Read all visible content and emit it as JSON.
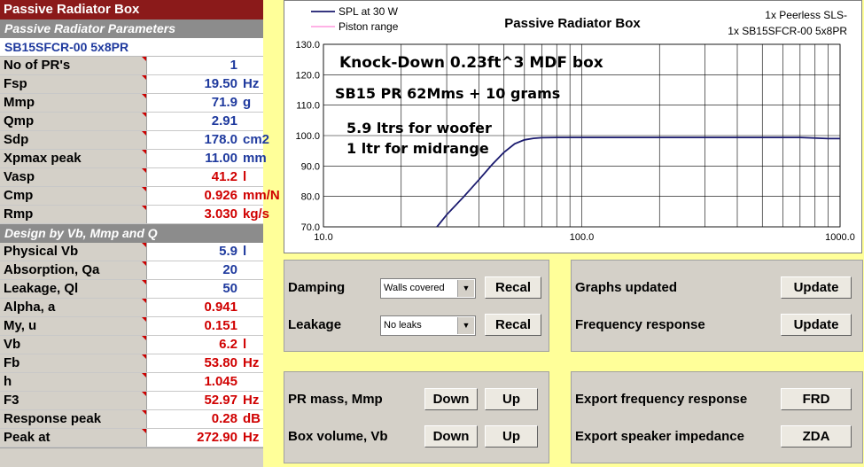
{
  "left": {
    "title": "Passive Radiator Box",
    "section1": "Passive Radiator Parameters",
    "model": "SB15SFCR-00 5x8PR",
    "params": [
      {
        "label": "No of PR's",
        "value": "1",
        "unit": "",
        "color": "blue"
      },
      {
        "label": "Fsp",
        "value": "19.50",
        "unit": "Hz",
        "color": "blue"
      },
      {
        "label": "Mmp",
        "value": "71.9",
        "unit": "g",
        "color": "blue"
      },
      {
        "label": "Qmp",
        "value": "2.91",
        "unit": "",
        "color": "blue"
      },
      {
        "label": "Sdp",
        "value": "178.0",
        "unit": "cm2",
        "color": "blue"
      },
      {
        "label": "Xpmax peak",
        "value": "11.00",
        "unit": "mm",
        "color": "blue"
      },
      {
        "label": "Vasp",
        "value": "41.2",
        "unit": "l",
        "color": "red"
      },
      {
        "label": "Cmp",
        "value": "0.926",
        "unit": "mm/N",
        "color": "red"
      },
      {
        "label": "Rmp",
        "value": "3.030",
        "unit": "kg/s",
        "color": "red"
      }
    ],
    "section2": "Design by Vb, Mmp and Q",
    "design": [
      {
        "label": "Physical Vb",
        "value": "5.9",
        "unit": "l",
        "color": "blue"
      },
      {
        "label": "Absorption, Qa",
        "value": "20",
        "unit": "",
        "color": "blue"
      },
      {
        "label": "Leakage, Ql",
        "value": "50",
        "unit": "",
        "color": "blue"
      },
      {
        "label": "Alpha, a",
        "value": "0.941",
        "unit": "",
        "color": "red"
      },
      {
        "label": "My, u",
        "value": "0.151",
        "unit": "",
        "color": "red"
      },
      {
        "label": "Vb",
        "value": "6.2",
        "unit": "l",
        "color": "red"
      },
      {
        "label": "Fb",
        "value": "53.80",
        "unit": "Hz",
        "color": "red"
      },
      {
        "label": "h",
        "value": "1.045",
        "unit": "",
        "color": "red"
      },
      {
        "label": "F3",
        "value": "52.97",
        "unit": "Hz",
        "color": "red"
      },
      {
        "label": "Response peak",
        "value": "0.28",
        "unit": "dB",
        "color": "red"
      },
      {
        "label": "Peak at",
        "value": "272.90",
        "unit": "Hz",
        "color": "red"
      }
    ]
  },
  "chart_data": {
    "type": "line",
    "title": "Passive Radiator Box",
    "subtitle_right": [
      "1x Peerless SLS-",
      "1x SB15SFCR-00 5x8PR"
    ],
    "legend": [
      {
        "name": "SPL at 30 W",
        "color": "#1a1a6e"
      },
      {
        "name": "Piston range",
        "color": "#ff66cc"
      }
    ],
    "annotations": [
      "Knock-Down 0.23ft^3 MDF box",
      "SB15 PR 62Mms + 10 grams",
      "5.9 ltrs for woofer",
      "1 ltr for midrange"
    ],
    "x_scale": "log",
    "xlim": [
      10,
      1000
    ],
    "ylim": [
      70,
      130
    ],
    "x_ticks": [
      "10.0",
      "100.0",
      "1000.0"
    ],
    "y_ticks": [
      "70.0",
      "80.0",
      "90.0",
      "100.0",
      "110.0",
      "120.0",
      "130.0"
    ],
    "grid": true,
    "series": [
      {
        "name": "SPL at 30 W",
        "x": [
          27.5,
          30,
          35,
          40,
          45,
          50,
          55,
          60,
          65,
          70,
          80,
          100,
          150,
          200,
          300,
          500,
          700,
          900,
          1000
        ],
        "y": [
          70.0,
          74.0,
          80.0,
          85.5,
          90.5,
          94.5,
          97.3,
          98.6,
          99.1,
          99.3,
          99.4,
          99.4,
          99.4,
          99.4,
          99.4,
          99.4,
          99.4,
          99.0,
          99.0
        ]
      }
    ]
  },
  "controls": {
    "damping_label": "Damping",
    "damping_value": "Walls covered",
    "leakage_label": "Leakage",
    "leakage_value": "No leaks",
    "recal": "Recal",
    "graphs_updated": "Graphs updated",
    "frequency_response": "Frequency response",
    "update": "Update",
    "pr_mass": "PR mass, Mmp",
    "box_volume": "Box volume, Vb",
    "down": "Down",
    "up": "Up",
    "export_fr": "Export frequency response",
    "export_imp": "Export speaker impedance",
    "frd": "FRD",
    "zda": "ZDA"
  }
}
